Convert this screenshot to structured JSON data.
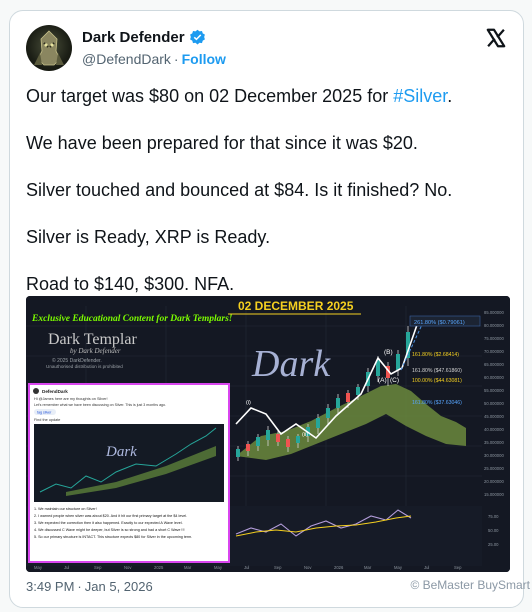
{
  "author": {
    "name": "Dark Defender",
    "handle": "@DefendDark",
    "follow_label": "Follow"
  },
  "tweet": {
    "line1_prefix": "Our target was $80 on 02 December 2025 for ",
    "line1_hashtag": "#Silver",
    "line1_suffix": ".",
    "line2": "We have been prepared for that since it was $20.",
    "line3": "Silver touched and bounced at $84. Is it finished? No.",
    "line4": "Silver is Ready, XRP is Ready.",
    "line5": "Road to $140, $300. NFA."
  },
  "media": {
    "banner_text": "Exclusive Educational Content for Dark Templars!",
    "date_text": "02 DECEMBER 2025",
    "logo_title": "Dark Templar",
    "logo_sub": "by Dark Defender",
    "copyright": "© 2025 DarkDefender.",
    "copyright2": "Unauthorised distribution is prohibited",
    "dark_watermark": "Dark",
    "wave_labels": [
      "(B)",
      "(A)",
      "(C)",
      "(i)",
      "(ii)"
    ],
    "fib_labels": [
      "261.80% ($0.79061)",
      "161.80% ($2.68414)",
      "161.80% ($47.61860)",
      "100.00% ($44.63081)",
      "161.80% ($37.63046)"
    ],
    "inset": {
      "author_line": "DefendDark",
      "intro": "Hi @James here are my thoughts on Silver!",
      "intro2": "Let's remember what we have been discussing on Silver. This is just 3 months ago.",
      "tag": "tag silver",
      "find": "Find the update",
      "points": [
        "1. We maintain our structure on Silver!",
        "2. I warned people when silver was about $20. And it hit our first primary target at the $4 level.",
        "3. We expected the correction then it also happened. Exactly to our expected A Wave level.",
        "4. We discussed C Wave might be deeper, but Silver is so strong and had a short C Wave !!!",
        "5. So our primary structure is INTACT. This structure expects $80 for Silver in the upcoming term."
      ]
    },
    "right_axis": [
      "85.000000",
      "80.000000",
      "75.000000",
      "70.000000",
      "65.000000",
      "60.000000",
      "55.000000",
      "50.000000",
      "45.000000",
      "40.000000",
      "35.000000",
      "30.000000",
      "25.000000",
      "20.000000",
      "15.000000"
    ],
    "lower_axis": [
      "75.00",
      "50.00",
      "25.00"
    ],
    "time_axis": [
      "May",
      "Jul",
      "Sep",
      "Nov",
      "2025",
      "Mar",
      "May",
      "Jul",
      "Sep",
      "Nov",
      "2026",
      "Mar",
      "May",
      "Jul",
      "Sep"
    ]
  },
  "meta": {
    "time": "3:49 PM",
    "date": "Jan 5, 2026"
  },
  "watermark": "© BeMaster BuySmart",
  "colors": {
    "link": "#1d9bf0",
    "inset_border": "#d946ef",
    "banner_green": "#7CFC00",
    "date_gold": "#f5d020"
  }
}
